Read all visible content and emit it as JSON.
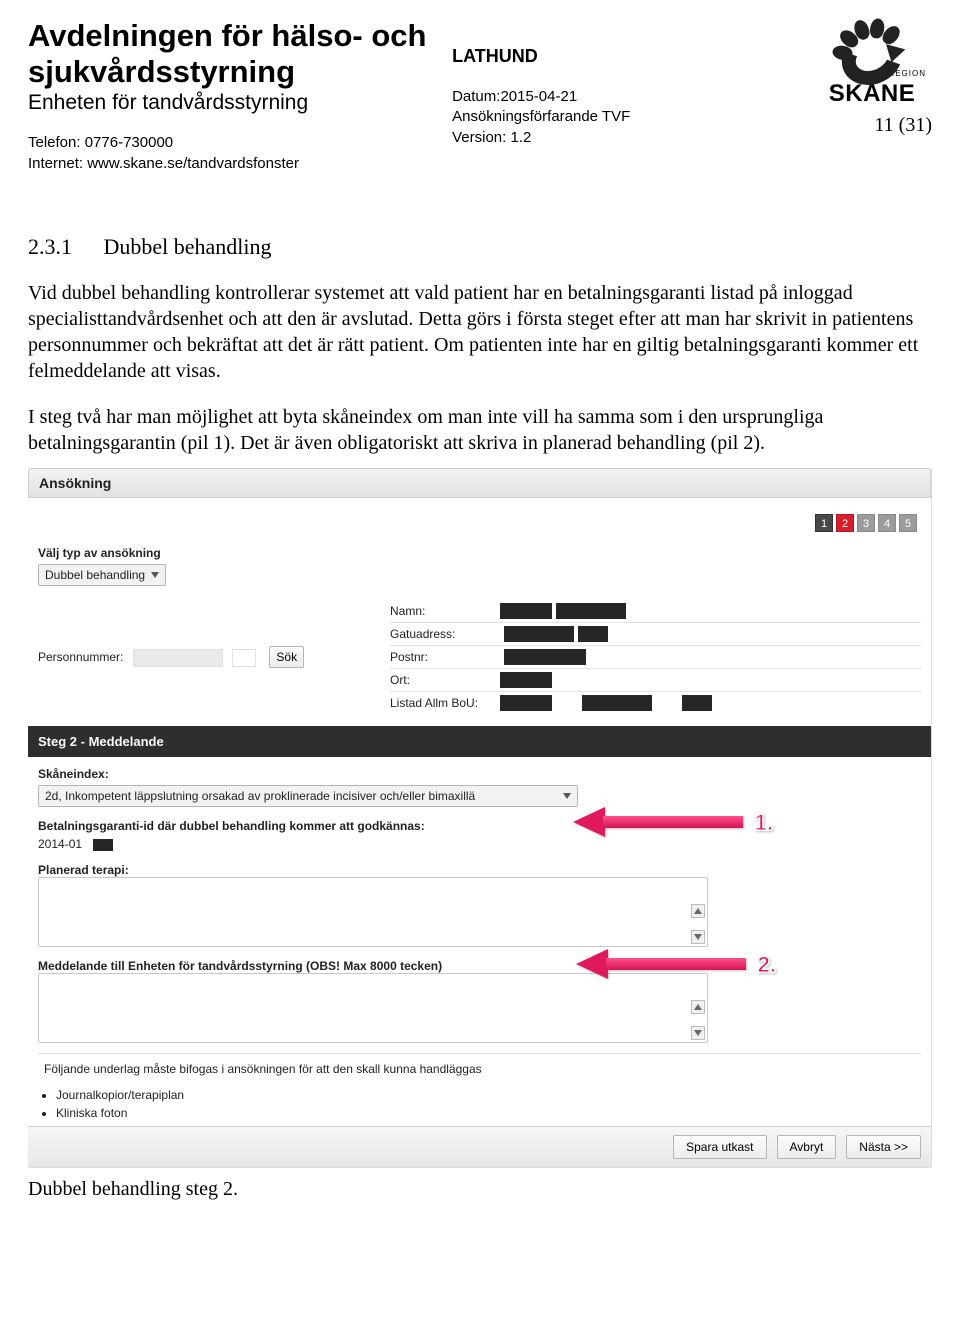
{
  "header": {
    "dept_title": "Avdelningen för hälso- och sjukvårdsstyrning",
    "unit_title": "Enheten för tandvårdsstyrning",
    "phone_label": "Telefon: 0776-730000",
    "internet_label": "Internet: www.skane.se/tandvardsfonster",
    "doc_type": "LATHUND",
    "date": "Datum:2015-04-21",
    "proc": "Ansökningsförfarande TVF",
    "version": "Version: 1.2",
    "page": "11 (31)",
    "logo_region": "REGION",
    "logo_text": "SKÅNE"
  },
  "section": {
    "number": "2.3.1",
    "title": "Dubbel behandling"
  },
  "paragraphs": {
    "p1": "Vid dubbel behandling kontrollerar systemet att vald patient har en betalningsgaranti listad på inloggad specialisttandvårdsenhet och att den är avslutad. Detta görs i första steget efter att man har skrivit in patientens personnummer och bekräftat att det är rätt patient. Om patienten inte har en giltig betalningsgaranti kommer ett felmeddelande att visas.",
    "p2": "I steg två har man möjlighet att byta skåneindex om man inte vill ha samma som i den ursprungliga betalningsgarantin (pil 1). Det är även obligatoriskt att skriva in planerad behandling (pil 2)."
  },
  "app": {
    "title": "Ansökning",
    "steps": [
      "1",
      "2",
      "3",
      "4",
      "5"
    ],
    "active_step": 2,
    "type_label": "Välj typ av ansökning",
    "type_value": "Dubbel behandling",
    "pn_label": "Personnummer:",
    "search_btn": "Sök",
    "info": {
      "name": "Namn:",
      "addr": "Gatuadress:",
      "zip": "Postnr:",
      "city": "Ort:",
      "list": "Listad Allm BoU:"
    },
    "step2_header": "Steg 2 - Meddelande",
    "skaneindex_label": "Skåneindex:",
    "skaneindex_value": "2d, Inkompetent läppslutning orsakad av proklinerade incisiver och/eller bimaxillä",
    "bg_label": "Betalningsgaranti-id där dubbel behandling kommer att godkännas:",
    "bg_value": "2014-01",
    "terapi_label": "Planerad terapi:",
    "msg_label": "Meddelande till Enheten för tandvårdsstyrning (OBS! Max 8000 tecken)",
    "attach_note": "Följande underlag måste bifogas i ansökningen för att den skall kunna handläggas",
    "attachments": [
      "Journalkopior/terapiplan",
      "Kliniska foton"
    ],
    "btn_save": "Spara utkast",
    "btn_cancel": "Avbryt",
    "btn_next": "Nästa >>"
  },
  "arrows": {
    "a1": "1.",
    "a2": "2."
  },
  "caption": "Dubbel behandling steg 2."
}
